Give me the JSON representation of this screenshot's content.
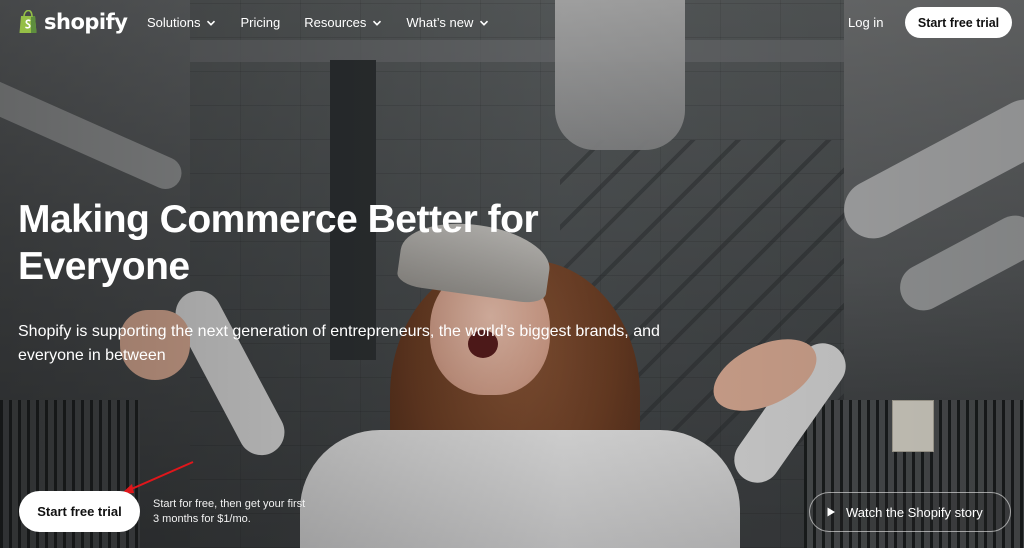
{
  "brand": {
    "name": "shopify",
    "logo_icon": "shopping-bag-icon",
    "color": "#95bf47"
  },
  "nav": {
    "items": [
      {
        "label": "Solutions",
        "has_dropdown": true
      },
      {
        "label": "Pricing",
        "has_dropdown": false
      },
      {
        "label": "Resources",
        "has_dropdown": true
      },
      {
        "label": "What’s new",
        "has_dropdown": true
      }
    ],
    "login_label": "Log in",
    "cta_label": "Start free trial"
  },
  "hero": {
    "title": "Making Commerce Better for Everyone",
    "subtitle": "Shopify is supporting the next generation of entrepreneurs, the world’s biggest brands, and everyone in between",
    "cta_label": "Start free trial",
    "cta_note": "Start for free, then get your first 3 months for $1/mo.",
    "story_label": "Watch the Shopify story",
    "story_icon": "play-icon",
    "annotation_color": "#e0161b"
  }
}
